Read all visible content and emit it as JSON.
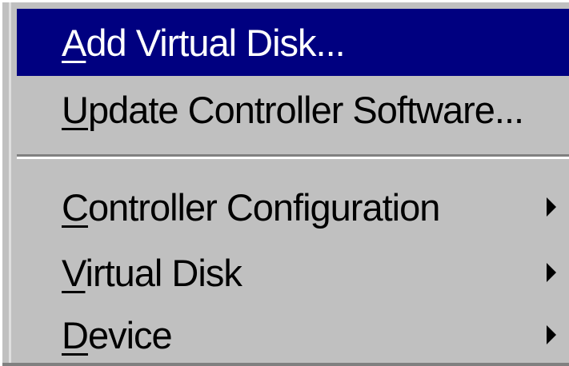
{
  "menu": {
    "items": [
      {
        "accel": "A",
        "rest": "dd Virtual Disk...",
        "selected": true,
        "submenu": false
      },
      {
        "accel": "U",
        "rest": "pdate Controller Software...",
        "selected": false,
        "submenu": false
      },
      {
        "accel": "C",
        "rest": "ontroller Configuration",
        "selected": false,
        "submenu": true
      },
      {
        "accel": "V",
        "rest": "irtual Disk",
        "selected": false,
        "submenu": true
      },
      {
        "accel": "D",
        "rest": "evice",
        "selected": false,
        "submenu": true
      }
    ]
  },
  "colors": {
    "menu_bg": "#c0c0c0",
    "selection_bg": "#000080",
    "selection_text": "#ffffff",
    "text": "#000000"
  },
  "icons": {
    "submenu": "submenu-arrow-icon"
  }
}
